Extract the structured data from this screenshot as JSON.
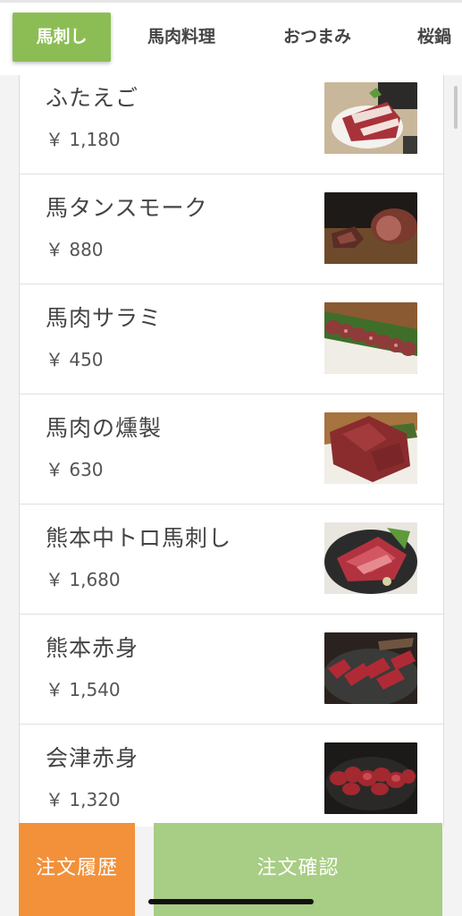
{
  "tabs": [
    {
      "label": "馬刺し",
      "active": true
    },
    {
      "label": "馬肉料理",
      "active": false
    },
    {
      "label": "おつまみ",
      "active": false
    },
    {
      "label": "桜鍋",
      "active": false
    }
  ],
  "menu_items": [
    {
      "name": "ふたえご",
      "price": "￥ 1,180"
    },
    {
      "name": "馬タンスモーク",
      "price": "￥ 880"
    },
    {
      "name": "馬肉サラミ",
      "price": "￥ 450"
    },
    {
      "name": "馬肉の燻製",
      "price": "￥ 630"
    },
    {
      "name": "熊本中トロ馬刺し",
      "price": "￥ 1,680"
    },
    {
      "name": "熊本赤身",
      "price": "￥ 1,540"
    },
    {
      "name": "会津赤身",
      "price": "￥ 1,320"
    }
  ],
  "footer": {
    "history_label": "注文履歴",
    "confirm_label": "注文確認"
  },
  "colors": {
    "active_tab": "#8cbd55",
    "history_button": "#f2913a",
    "confirm_button": "#a8cd85"
  }
}
